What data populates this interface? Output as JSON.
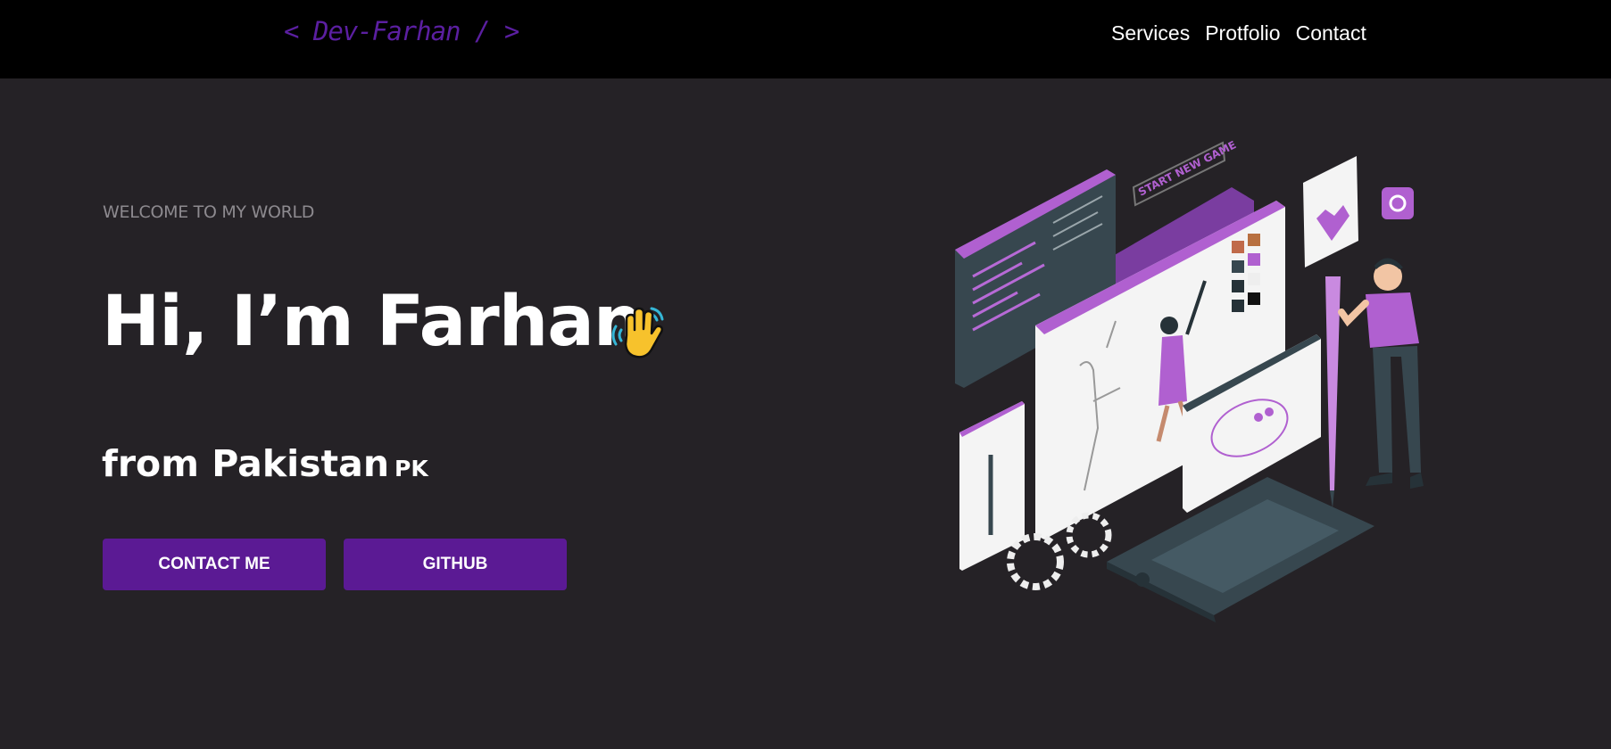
{
  "header": {
    "logo": "< Dev-Farhan / >",
    "nav": [
      "Services",
      "Protfolio",
      "Contact"
    ]
  },
  "hero": {
    "eyebrow": "WELCOME TO MY WORLD",
    "title": "Hi, I’m Farhan",
    "subtitle": "from Pakistan",
    "country_code": "PK",
    "wave_icon": "waving-hand-icon",
    "buttons": {
      "contact": "CONTACT ME",
      "github": "GITHUB"
    }
  },
  "illustration": {
    "badge_text": "START NEW GAME",
    "icon": "developer-workstation-illustration"
  },
  "colors": {
    "page_bg": "#252226",
    "topbar_bg": "#000000",
    "accent": "#5b1a94",
    "muted_text": "#8d8a8f",
    "illustration_purple": "#b060d0"
  }
}
